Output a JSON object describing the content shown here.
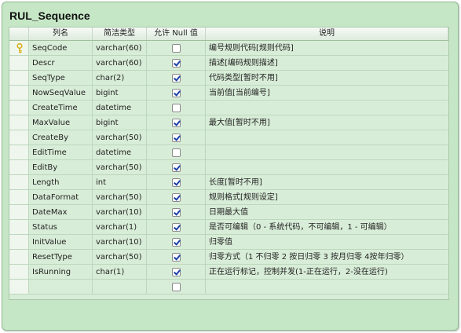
{
  "table_title": "RUL_Sequence",
  "headers": {
    "name": "列名",
    "type": "简洁类型",
    "null": "允许 Null 值",
    "desc": "说明"
  },
  "rows": [
    {
      "name": "SeqCode",
      "type": "varchar(60)",
      "nullable": false,
      "primary_key": true,
      "desc": "编号规则代码[规则代码]"
    },
    {
      "name": "Descr",
      "type": "varchar(60)",
      "nullable": true,
      "primary_key": false,
      "desc": "描述[编码规则描述]"
    },
    {
      "name": "SeqType",
      "type": "char(2)",
      "nullable": true,
      "primary_key": false,
      "desc": "代码类型[暂时不用]"
    },
    {
      "name": "NowSeqValue",
      "type": "bigint",
      "nullable": true,
      "primary_key": false,
      "desc": "当前值[当前编号]"
    },
    {
      "name": "CreateTime",
      "type": "datetime",
      "nullable": false,
      "primary_key": false,
      "desc": ""
    },
    {
      "name": "MaxValue",
      "type": "bigint",
      "nullable": true,
      "primary_key": false,
      "desc": "最大值[暂时不用]"
    },
    {
      "name": "CreateBy",
      "type": "varchar(50)",
      "nullable": true,
      "primary_key": false,
      "desc": ""
    },
    {
      "name": "EditTime",
      "type": "datetime",
      "nullable": false,
      "primary_key": false,
      "desc": ""
    },
    {
      "name": "EditBy",
      "type": "varchar(50)",
      "nullable": true,
      "primary_key": false,
      "desc": ""
    },
    {
      "name": "Length",
      "type": "int",
      "nullable": true,
      "primary_key": false,
      "desc": "长度[暂时不用]"
    },
    {
      "name": "DataFormat",
      "type": "varchar(50)",
      "nullable": true,
      "primary_key": false,
      "desc": "规则格式[规则设定]"
    },
    {
      "name": "DateMax",
      "type": "varchar(10)",
      "nullable": true,
      "primary_key": false,
      "desc": "日期最大值"
    },
    {
      "name": "Status",
      "type": "varchar(1)",
      "nullable": true,
      "primary_key": false,
      "desc": "是否可编辑（0 - 系统代码，不可编辑，1 - 可编辑）"
    },
    {
      "name": "InitValue",
      "type": "varchar(10)",
      "nullable": true,
      "primary_key": false,
      "desc": "归零值"
    },
    {
      "name": "ResetType",
      "type": "varchar(50)",
      "nullable": true,
      "primary_key": false,
      "desc": "归零方式（1 不归零 2 按日归零  3 按月归零  4按年归零）"
    },
    {
      "name": "IsRunning",
      "type": "char(1)",
      "nullable": true,
      "primary_key": false,
      "desc": "正在运行标记，控制并发(1-正在运行，2-没在运行)"
    },
    {
      "name": "",
      "type": "",
      "nullable": false,
      "primary_key": false,
      "desc": ""
    }
  ],
  "colors": {
    "frame": "#c6e7c6",
    "grid": "#d8edd8",
    "check": "#1a3fa8",
    "key": "#d9b11c"
  },
  "icons": {
    "primary_key": "key-icon",
    "checkbox": "checkbox-icon"
  }
}
